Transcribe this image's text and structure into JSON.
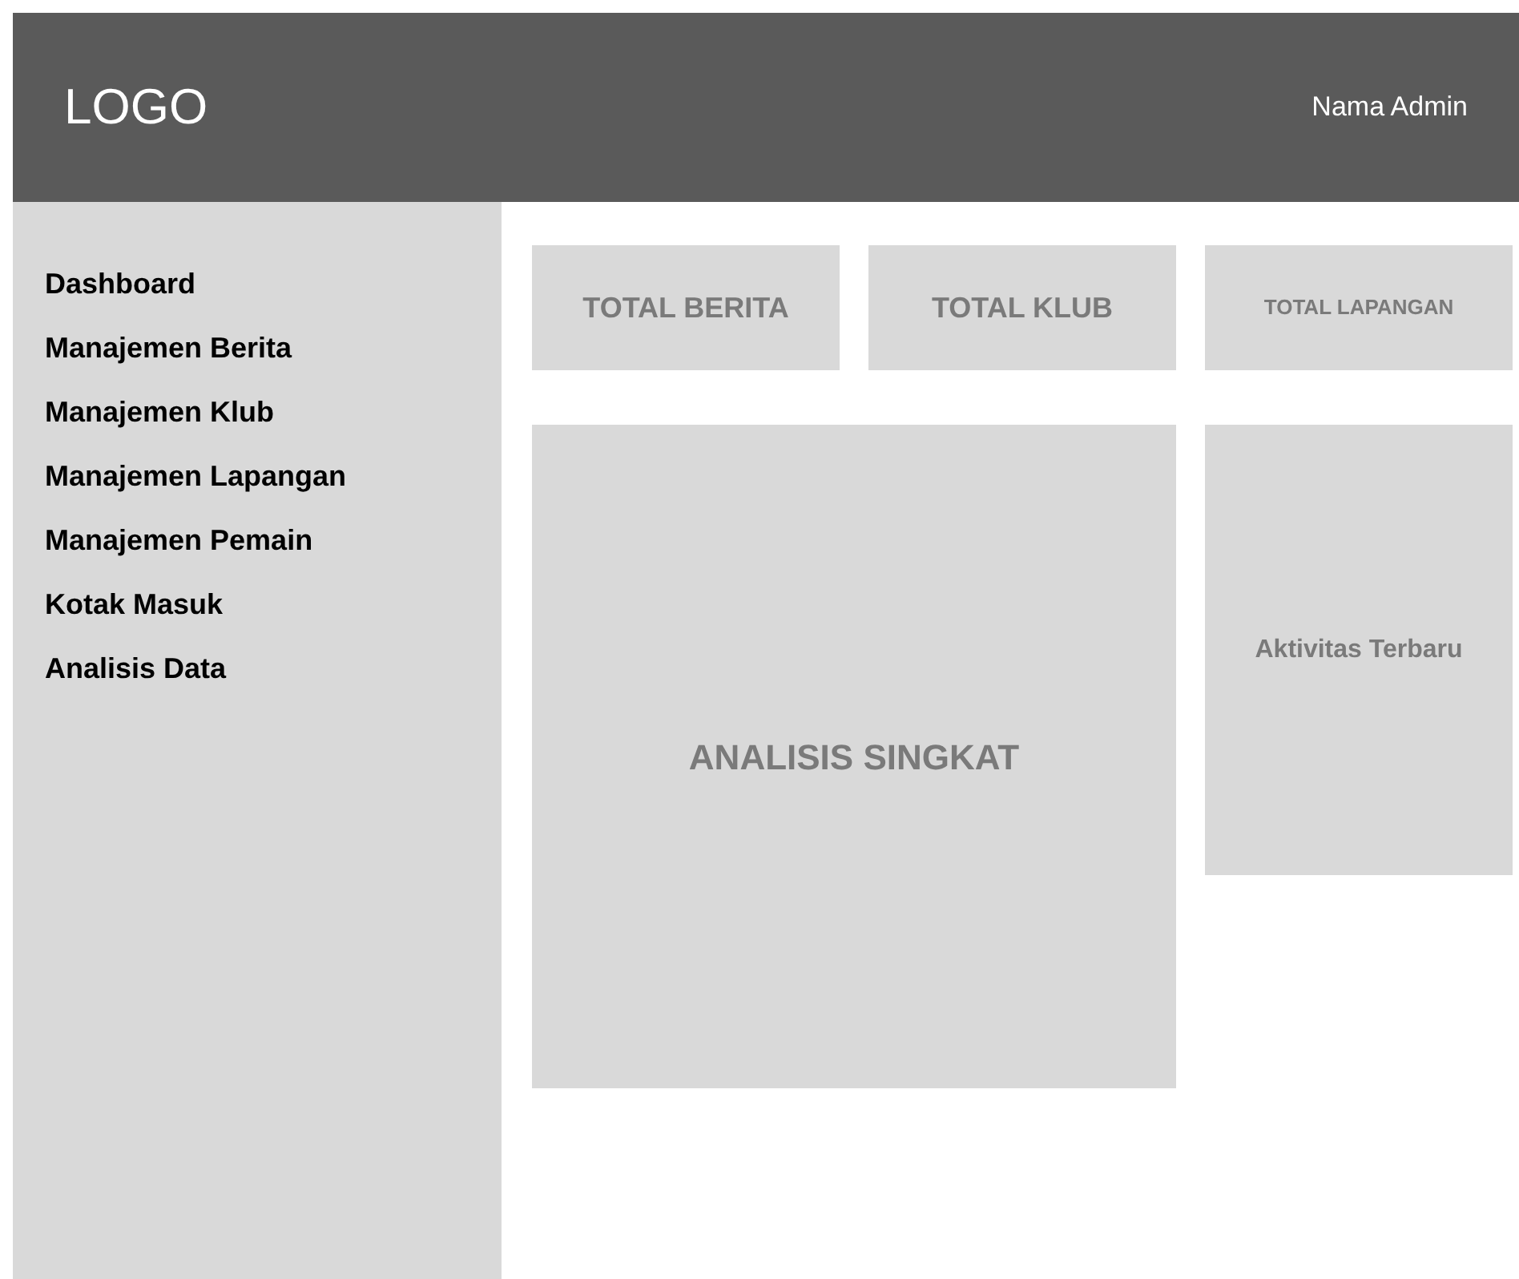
{
  "header": {
    "logo": "LOGO",
    "user": "Nama Admin"
  },
  "sidebar": {
    "items": [
      "Dashboard",
      "Manajemen Berita",
      "Manajemen Klub",
      "Manajemen Lapangan",
      "Manajemen Pemain",
      "Kotak Masuk",
      "Analisis Data"
    ]
  },
  "stats": [
    {
      "label": "TOTAL BERITA",
      "kind": "large"
    },
    {
      "label": "TOTAL KLUB",
      "kind": "large"
    },
    {
      "label": "TOTAL LAPANGAN",
      "kind": "small"
    }
  ],
  "panels": {
    "analysis": "ANALISIS SINGKAT",
    "activity": "Aktivitas Terbaru"
  }
}
